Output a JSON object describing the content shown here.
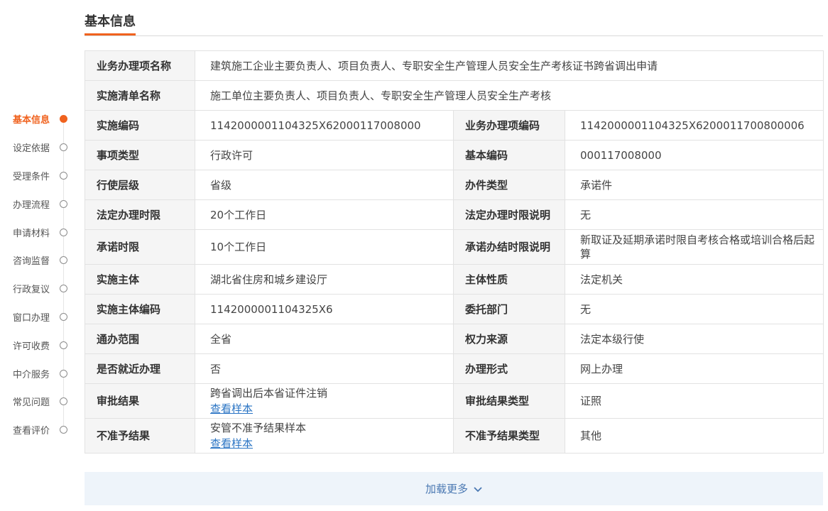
{
  "section": {
    "title": "基本信息"
  },
  "side_nav": {
    "items": [
      {
        "label": "基本信息",
        "active": true
      },
      {
        "label": "设定依据"
      },
      {
        "label": "受理条件"
      },
      {
        "label": "办理流程"
      },
      {
        "label": "申请材料"
      },
      {
        "label": "咨询监督"
      },
      {
        "label": "行政复议"
      },
      {
        "label": "窗口办理"
      },
      {
        "label": "许可收费"
      },
      {
        "label": "中介服务"
      },
      {
        "label": "常见问题"
      },
      {
        "label": "查看评价"
      }
    ]
  },
  "table": {
    "full_rows": [
      {
        "label": "业务办理项名称",
        "value": "建筑施工企业主要负责人、项目负责人、专职安全生产管理人员安全生产考核证书跨省调出申请"
      },
      {
        "label": "实施清单名称",
        "value": "施工单位主要负责人、项目负责人、专职安全生产管理人员安全生产考核"
      }
    ],
    "rows": [
      {
        "l1": "实施编码",
        "v1": "1142000001104325X62000117008000",
        "l2": "业务办理项编码",
        "v2": "1142000001104325X6200011700800006"
      },
      {
        "l1": "事项类型",
        "v1": "行政许可",
        "l2": "基本编码",
        "v2": "000117008000"
      },
      {
        "l1": "行使层级",
        "v1": "省级",
        "l2": "办件类型",
        "v2": "承诺件"
      },
      {
        "l1": "法定办理时限",
        "v1": "20个工作日",
        "l2": "法定办理时限说明",
        "v2": "无"
      },
      {
        "l1": "承诺时限",
        "v1": "10个工作日",
        "l2": "承诺办结时限说明",
        "v2": "新取证及延期承诺时限自考核合格或培训合格后起算"
      },
      {
        "l1": "实施主体",
        "v1": "湖北省住房和城乡建设厅",
        "l2": "主体性质",
        "v2": "法定机关"
      },
      {
        "l1": "实施主体编码",
        "v1": "1142000001104325X6",
        "l2": "委托部门",
        "v2": "无"
      },
      {
        "l1": "通办范围",
        "v1": "全省",
        "l2": "权力来源",
        "v2": "法定本级行使"
      },
      {
        "l1": "是否就近办理",
        "v1": "否",
        "l2": "办理形式",
        "v2": "网上办理"
      },
      {
        "l1": "审批结果",
        "v1": "跨省调出后本省证件注销",
        "v1_link": "查看样本",
        "l2": "审批结果类型",
        "v2": "证照"
      },
      {
        "l1": "不准予结果",
        "v1": "安管不准予结果样本",
        "v1_link": "查看样本",
        "l2": "不准予结果类型",
        "v2": "其他"
      }
    ]
  },
  "load_more": {
    "label": "加载更多",
    "icon": "chevron-down-icon"
  },
  "colors": {
    "accent": "#f0621e",
    "link": "#2a74c4",
    "label_bg": "#f5f5f5",
    "load_more_bg": "#eef4fa"
  }
}
